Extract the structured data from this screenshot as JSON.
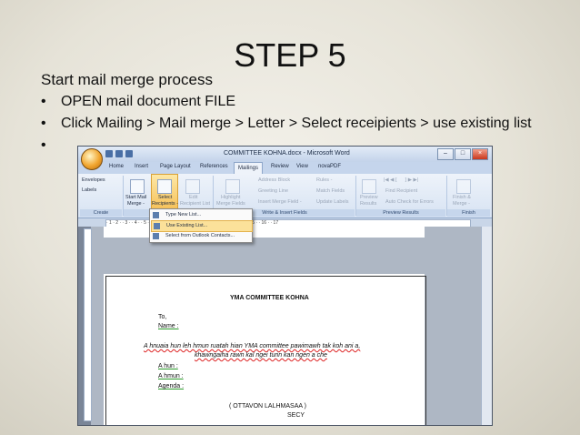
{
  "slide": {
    "title": "STEP 5",
    "subtitle": "Start mail merge process",
    "bullets": [
      "OPEN  mail document FILE",
      "Click Mailing >  Mail merge > Letter  > Select receipients > use existing list",
      ""
    ]
  },
  "word": {
    "window_title": "COMMITTEE KOHNA.docx - Microsoft Word",
    "tabs": [
      "Home",
      "Insert",
      "Page Layout",
      "References",
      "Mailings",
      "Review",
      "View",
      "novaPDF"
    ],
    "active_tab": "Mailings",
    "ribbon": {
      "envelopes": "Envelopes",
      "labels": "Labels",
      "create_group": "Create",
      "start_mail_merge": [
        "Start Mail",
        "Merge -"
      ],
      "select_recipients": [
        "Select",
        "Recipients -"
      ],
      "edit_recipient": [
        "Edit",
        "Recipient List"
      ],
      "highlight": [
        "Highlight",
        "Merge Fields"
      ],
      "address_block": "Address Block",
      "greeting_line": "Greeting Line",
      "insert_merge_field": "Insert Merge Field -",
      "rules": "Rules -",
      "match_fields": "Match Fields",
      "update_labels": "Update Labels",
      "write_group": "Write & Insert Fields",
      "preview": [
        "Preview",
        "Results"
      ],
      "find_recipient": "Find Recipient",
      "auto_check": "Auto Check for Errors",
      "preview_group": "Preview Results",
      "finish": [
        "Finish &",
        "Merge -"
      ],
      "finish_group": "Finish"
    },
    "menu": [
      "Type New List...",
      "Use Existing List...",
      "Select from Outlook Contacts..."
    ],
    "menu_highlighted_index": 1,
    "ruler": "· 1 · 2 · · 3 · · 4 · · 5 · · 6 · · 7 · · 8 · · 9 · · 10 · · 11 · · 12 · · 13 · · 14 · · 15 · · 16 · · 17",
    "document": {
      "heading": "YMA COMMITTEE KOHNA",
      "to": "To,",
      "name": "Name  :",
      "body_line1": "A hnuaia hun leh hmun ruatah hian YMA committee pawimawh tak koh ani a,",
      "body_line2": "khawngaiha rawn kal ngei turin kan ngen a che",
      "ahun": "A hun :",
      "ahmun": "A hmun :",
      "agenda": "Agenda :",
      "ottavon": "( OTTAVON LALHMASAA )",
      "secy": "SECY"
    }
  }
}
